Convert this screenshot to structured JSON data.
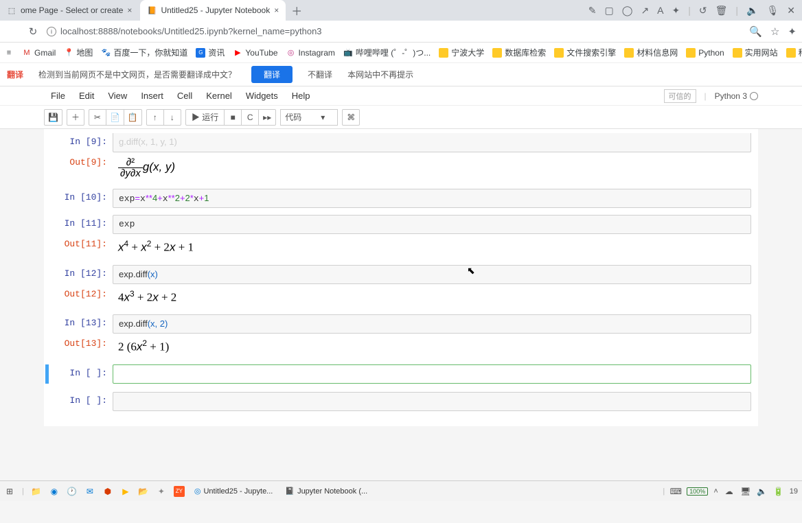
{
  "tabs": {
    "tab1": {
      "title": "ome Page - Select or create",
      "close": "×"
    },
    "tab2": {
      "title": "Untitled25 - Jupyter Notebook",
      "close": "×"
    },
    "newtab": "＋"
  },
  "tab_controls": [
    "✎",
    "▢",
    "◯",
    "↗",
    "A",
    "✦",
    "|",
    "↺",
    "🗑",
    "|",
    "🔈",
    "🎙",
    "✕"
  ],
  "addr": {
    "reload": "↻",
    "url": "localhost:8888/notebooks/Untitled25.ipynb?kernel_name=python3",
    "zoom": "🔍",
    "star": "☆",
    "ext": "✦"
  },
  "bookmarks": [
    {
      "icon": "≡",
      "label": ""
    },
    {
      "icon": "M",
      "label": "Gmail",
      "color": "#d93025"
    },
    {
      "icon": "📍",
      "label": "地图",
      "color": "#1a73e8"
    },
    {
      "icon": "🐾",
      "label": "百度一下，你就知道",
      "color": "#2b66d9"
    },
    {
      "icon": "G",
      "label": "资讯",
      "color": "#1a73e8"
    },
    {
      "icon": "▶",
      "label": "YouTube",
      "color": "#ff0000"
    },
    {
      "icon": "◎",
      "label": "Instagram",
      "color": "#c13584"
    },
    {
      "icon": "📺",
      "label": "哔哩哔哩 (゜-゜)つ...",
      "color": "#00a1d6"
    },
    {
      "icon": "folder",
      "label": "宁波大学"
    },
    {
      "icon": "folder",
      "label": "数据库检索"
    },
    {
      "icon": "folder",
      "label": "文件搜索引擎"
    },
    {
      "icon": "folder",
      "label": "材料信息网"
    },
    {
      "icon": "folder",
      "label": "Python"
    },
    {
      "icon": "folder",
      "label": "实用网站"
    },
    {
      "icon": "folder",
      "label": "科研知识"
    }
  ],
  "translate": {
    "label": "翻译",
    "msg": "检测到当前网页不是中文网页，是否需要翻译成中文？",
    "btn_translate": "翻译",
    "btn_no": "不翻译",
    "btn_never": "本网站中不再提示"
  },
  "menu": [
    "File",
    "Edit",
    "View",
    "Insert",
    "Cell",
    "Kernel",
    "Widgets",
    "Help"
  ],
  "trusted": "可信的",
  "kernel": "Python 3",
  "toolbar": {
    "save": "💾",
    "add": "＋",
    "cut": "✂",
    "copy": "📄",
    "paste": "📋",
    "up": "↑",
    "down": "↓",
    "run": "▶ 运行",
    "stop": "■",
    "restart": "C",
    "ff": "▸▸",
    "celltype": "代码",
    "cmd": "⌘"
  },
  "cells": {
    "in9_prompt": "In  [9]:",
    "in9_code": "g.diff(x, 1, y, 1)",
    "out9_prompt": "Out[9]:",
    "in10_prompt": "In  [10]:",
    "in10_code": "exp=x**4+x**2+2*x+1",
    "in11_prompt": "In  [11]:",
    "in11_code": "exp",
    "out11_prompt": "Out[11]:",
    "out11_val": "x⁴ + x² + 2x + 1",
    "in12_prompt": "In  [12]:",
    "in12_code_a": "exp.diff",
    "in12_code_b": "(x)",
    "out12_prompt": "Out[12]:",
    "out12_val": "4x³ + 2x + 2",
    "in13_prompt": "In  [13]:",
    "in13_code_a": "exp.diff",
    "in13_code_b": "(x, 2)",
    "out13_prompt": "Out[13]:",
    "out13_val": "2 (6x² + 1)",
    "inblank_prompt": "In  [ ]:"
  },
  "math9": {
    "top": "∂²",
    "bot": "∂y∂x",
    "tail": "g(x, y)"
  },
  "taskbar": {
    "items": [
      {
        "icon": "📧",
        "label": "Untitled25 - Jupyte..."
      },
      {
        "icon": "📓",
        "label": "Jupyter Notebook (..."
      }
    ],
    "battery": "100%",
    "time": "19"
  }
}
